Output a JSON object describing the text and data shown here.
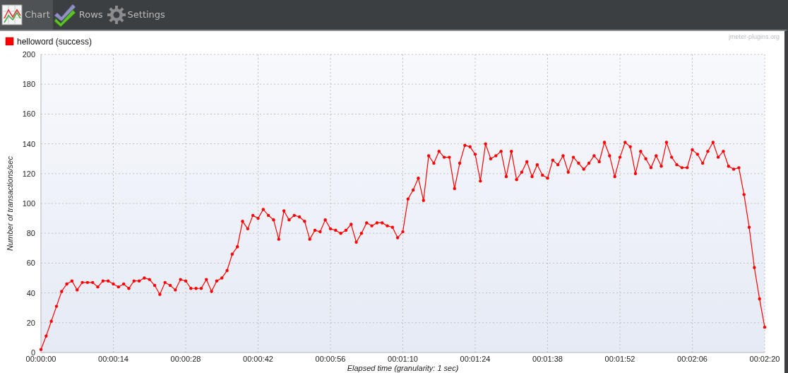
{
  "toolbar": {
    "tabs": [
      {
        "label": "Chart",
        "kind": "chart",
        "selected": true
      },
      {
        "label": "Rows",
        "kind": "rows",
        "selected": false
      },
      {
        "label": "Settings",
        "kind": "settings",
        "selected": false
      }
    ]
  },
  "chart": {
    "brand": "jmeter-plugins.org",
    "chart_data": {
      "type": "line",
      "xlabel": "Elapsed time (granularity: 1 sec)",
      "ylabel": "Number of transactions/sec",
      "x": [
        0,
        1,
        2,
        3,
        4,
        5,
        6,
        7,
        8,
        9,
        10,
        11,
        12,
        13,
        14,
        15,
        16,
        17,
        18,
        19,
        20,
        21,
        22,
        23,
        24,
        25,
        26,
        27,
        28,
        29,
        30,
        31,
        32,
        33,
        34,
        35,
        36,
        37,
        38,
        39,
        40,
        41,
        42,
        43,
        44,
        45,
        46,
        47,
        48,
        49,
        50,
        51,
        52,
        53,
        54,
        55,
        56,
        57,
        58,
        59,
        60,
        61,
        62,
        63,
        64,
        65,
        66,
        67,
        68,
        69,
        70,
        71,
        72,
        73,
        74,
        75,
        76,
        77,
        78,
        79,
        80,
        81,
        82,
        83,
        84,
        85,
        86,
        87,
        88,
        89,
        90,
        91,
        92,
        93,
        94,
        95,
        96,
        97,
        98,
        99,
        100,
        101,
        102,
        103,
        104,
        105,
        106,
        107,
        108,
        109,
        110,
        111,
        112,
        113,
        114,
        115,
        116,
        117,
        118,
        119,
        120,
        121,
        122,
        123,
        124,
        125,
        126,
        127,
        128,
        129,
        130,
        131,
        132,
        133,
        134,
        135,
        136,
        137,
        138,
        139,
        140
      ],
      "series": [
        {
          "name": "helloword (success)",
          "color": "#ff0000",
          "values": [
            2,
            11,
            21,
            31,
            41,
            46,
            48,
            42,
            47,
            47,
            47,
            44,
            48,
            48,
            46,
            44,
            46,
            43,
            48,
            48,
            50,
            49,
            45,
            39,
            47,
            45,
            42,
            49,
            48,
            43,
            43,
            43,
            49,
            41,
            48,
            50,
            55,
            66,
            71,
            88,
            83,
            92,
            90,
            96,
            92,
            89,
            76,
            95,
            89,
            92,
            91,
            88,
            76,
            82,
            81,
            89,
            83,
            82,
            80,
            82,
            86,
            74,
            80,
            87,
            85,
            87,
            87,
            85,
            84,
            77,
            81,
            103,
            109,
            117,
            102,
            132,
            127,
            135,
            131,
            131,
            110,
            127,
            139,
            138,
            133,
            115,
            140,
            130,
            132,
            135,
            118,
            135,
            116,
            121,
            128,
            118,
            126,
            119,
            117,
            129,
            126,
            132,
            121,
            131,
            127,
            123,
            127,
            132,
            128,
            141,
            132,
            118,
            131,
            141,
            138,
            120,
            135,
            130,
            124,
            132,
            125,
            141,
            131,
            126,
            124,
            124,
            136,
            133,
            127,
            135,
            141,
            131,
            135,
            125,
            123,
            124,
            106,
            84,
            57,
            36,
            17
          ]
        }
      ],
      "grid": true,
      "xlim": [
        0,
        140
      ],
      "ylim": [
        0,
        200
      ],
      "xticks": [
        {
          "value": 0,
          "label": "00:00:00"
        },
        {
          "value": 14,
          "label": "00:00:14"
        },
        {
          "value": 28,
          "label": "00:00:28"
        },
        {
          "value": 42,
          "label": "00:00:42"
        },
        {
          "value": 56,
          "label": "00:00:56"
        },
        {
          "value": 70,
          "label": "00:01:10"
        },
        {
          "value": 84,
          "label": "00:01:24"
        },
        {
          "value": 98,
          "label": "00:01:38"
        },
        {
          "value": 112,
          "label": "00:01:52"
        },
        {
          "value": 126,
          "label": "00:02:06"
        },
        {
          "value": 140,
          "label": "00:02:20"
        }
      ],
      "yticks": [
        0,
        20,
        40,
        60,
        80,
        100,
        120,
        140,
        160,
        180,
        200
      ]
    }
  }
}
